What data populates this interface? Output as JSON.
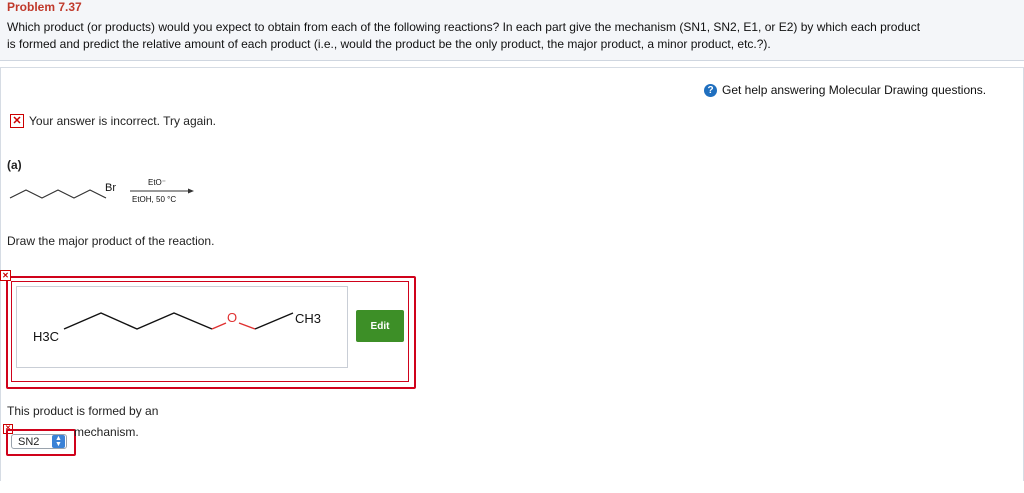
{
  "header": {
    "title": "Problem 7.37",
    "question_line1": "Which product (or products) would you expect to obtain from each of the following reactions? In each part give the mechanism (SN1, SN2, E1, or E2) by which each product",
    "question_line2": "is formed and predict the relative amount of each product (i.e., would the product be the only product, the major product, a minor product, etc.?)."
  },
  "help": {
    "label": "Get help answering Molecular Drawing questions.",
    "icon": "question-icon"
  },
  "feedback": {
    "incorrect_text": "Your answer is incorrect.  Try again.",
    "icon": "x-icon"
  },
  "part": {
    "label": "(a)",
    "reaction": {
      "leaving_group": "Br",
      "reagent_top": "EtO⁻",
      "reagent_bottom": "EtOH, 50 °C"
    },
    "draw_prompt": "Draw the major product of the reaction.",
    "answer": {
      "left_group": "H3C",
      "heteroatom": "O",
      "right_group": "CH3",
      "edit_label": "Edit"
    },
    "mechanism": {
      "prefix": "This product is formed by an",
      "suffix": "mechanism.",
      "selected": "SN2"
    }
  },
  "colors": {
    "error": "#d0021b",
    "edit_button": "#3d8f27",
    "title": "#c0392b",
    "oxygen": "#e03030"
  }
}
